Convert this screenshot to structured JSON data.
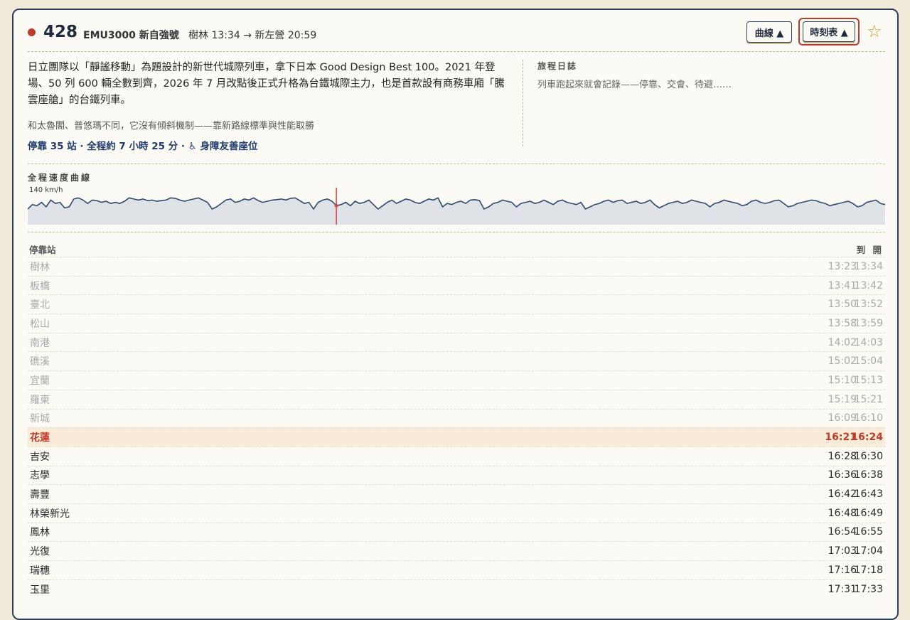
{
  "header": {
    "train_no": "428",
    "train_type": "EMU3000 新自強號",
    "route": "樹林 13:34 → 新左營 20:59",
    "btn_curve": "曲線 ▲",
    "btn_timetable": "時刻表 ▲",
    "star_icon": "☆",
    "status_color": "#c0392b"
  },
  "info": {
    "description": "日立團隊以「靜謐移動」為題設計的新世代城際列車，拿下日本 Good Design Best 100。2021 年登場、50 列 600 輛全數到齊，2026 年 7 月改點後正式升格為台鐵城際主力，也是首款設有商務車廂「騰雲座艙」的台鐵列車。",
    "subtitle": "和太魯閣、普悠瑪不同，它沒有傾斜機制——靠新路線標準與性能取勝",
    "meta": "停靠 35 站 · 全程約 7 小時 25 分 · ♿ 身障友善座位"
  },
  "journal": {
    "title": "旅程日誌",
    "text": "列車跑起來就會記錄——停靠、交會、待避……"
  },
  "curve": {
    "title": "全程速度曲線",
    "max_label": "140 km/h",
    "max_speed": 140,
    "current_position": 0.36,
    "line_color": "#2e4a6e",
    "fill_color": "#dfe2e6",
    "marker_color": "#d64545",
    "speeds": [
      70,
      90,
      85,
      100,
      80,
      110,
      95,
      100,
      75,
      80,
      115,
      120,
      110,
      95,
      110,
      108,
      100,
      105,
      95,
      100,
      95,
      105,
      120,
      115,
      110,
      115,
      108,
      110,
      105,
      108,
      110,
      120,
      118,
      110,
      105,
      110,
      115,
      120,
      110,
      100,
      70,
      80,
      95,
      110,
      115,
      100,
      105,
      115,
      110,
      120,
      108,
      100,
      105,
      110,
      112,
      115,
      110,
      118,
      120,
      108,
      95,
      100,
      70,
      100,
      110,
      115,
      105,
      85,
      90,
      100,
      85,
      105,
      95,
      100,
      110,
      90,
      70,
      85,
      100,
      110,
      95,
      105,
      115,
      110,
      100,
      95,
      105,
      115,
      110,
      120,
      80,
      95,
      90,
      100,
      105,
      95,
      110,
      112,
      108,
      70,
      80,
      95,
      100,
      110,
      105,
      100,
      80,
      95,
      100,
      105,
      95,
      100,
      110,
      100,
      90,
      105,
      110,
      100,
      95,
      90,
      100,
      70,
      80,
      90,
      95,
      105,
      110,
      100,
      108,
      110,
      95,
      100,
      105,
      95,
      100,
      110,
      90,
      75,
      85,
      95,
      100,
      105,
      95,
      100,
      110,
      105,
      100,
      95,
      80,
      95,
      100,
      110,
      105,
      100,
      95,
      85,
      90,
      105,
      110,
      100,
      95,
      100,
      108,
      110,
      95,
      80,
      85,
      95,
      100,
      105,
      110,
      108,
      100,
      95,
      85,
      90,
      95,
      100,
      105,
      95,
      80,
      85,
      100,
      105,
      110,
      95,
      90
    ]
  },
  "timetable": {
    "head_station": "停靠站",
    "head_times": "到 開",
    "rows": [
      {
        "station": "樹林",
        "arr": "13:23",
        "dep": "13:34",
        "state": "past"
      },
      {
        "station": "板橋",
        "arr": "13:41",
        "dep": "13:42",
        "state": "past"
      },
      {
        "station": "臺北",
        "arr": "13:50",
        "dep": "13:52",
        "state": "past"
      },
      {
        "station": "松山",
        "arr": "13:58",
        "dep": "13:59",
        "state": "past"
      },
      {
        "station": "南港",
        "arr": "14:02",
        "dep": "14:03",
        "state": "past"
      },
      {
        "station": "礁溪",
        "arr": "15:02",
        "dep": "15:04",
        "state": "past"
      },
      {
        "station": "宜蘭",
        "arr": "15:10",
        "dep": "15:13",
        "state": "past"
      },
      {
        "station": "羅東",
        "arr": "15:19",
        "dep": "15:21",
        "state": "past"
      },
      {
        "station": "新城",
        "arr": "16:09",
        "dep": "16:10",
        "state": "past"
      },
      {
        "station": "花蓮",
        "arr": "16:21",
        "dep": "16:24",
        "state": "current"
      },
      {
        "station": "吉安",
        "arr": "16:28",
        "dep": "16:30",
        "state": "future"
      },
      {
        "station": "志學",
        "arr": "16:36",
        "dep": "16:38",
        "state": "future"
      },
      {
        "station": "壽豐",
        "arr": "16:42",
        "dep": "16:43",
        "state": "future"
      },
      {
        "station": "林榮新光",
        "arr": "16:48",
        "dep": "16:49",
        "state": "future"
      },
      {
        "station": "鳳林",
        "arr": "16:54",
        "dep": "16:55",
        "state": "future"
      },
      {
        "station": "光復",
        "arr": "17:03",
        "dep": "17:04",
        "state": "future"
      },
      {
        "station": "瑞穗",
        "arr": "17:16",
        "dep": "17:18",
        "state": "future"
      },
      {
        "station": "玉里",
        "arr": "17:31",
        "dep": "17:33",
        "state": "future"
      }
    ]
  }
}
